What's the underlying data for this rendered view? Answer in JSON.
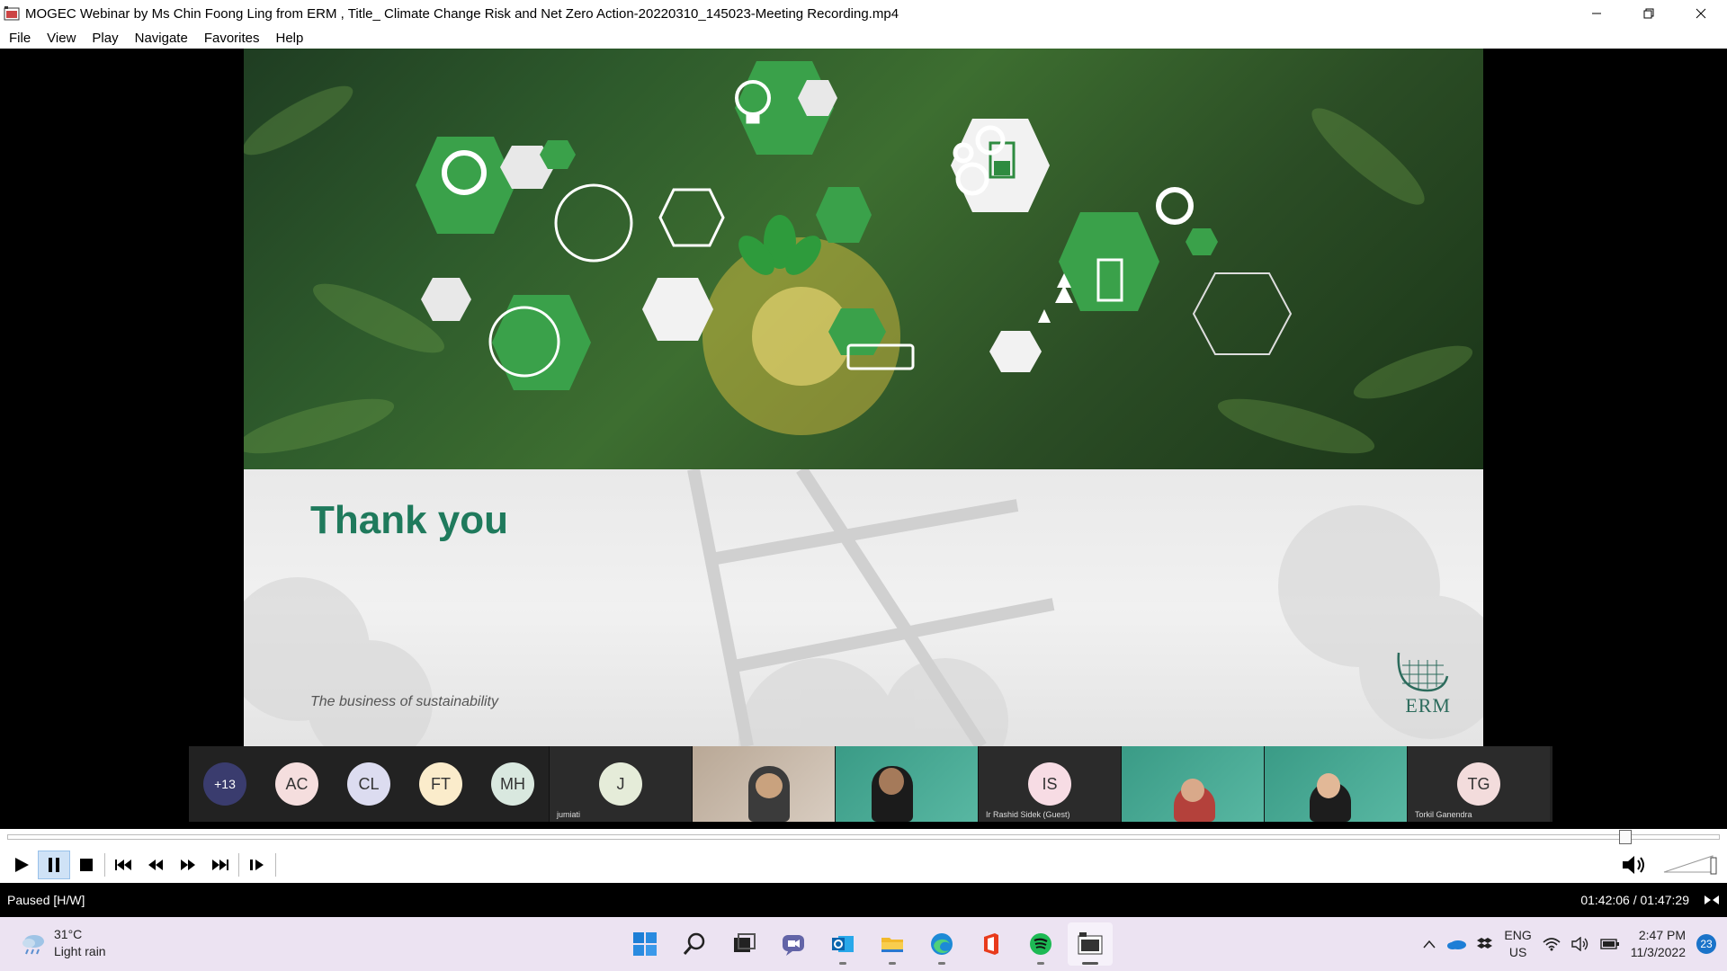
{
  "window": {
    "title": "MOGEC Webinar by Ms Chin Foong Ling from ERM , Title_ Climate Change Risk and Net Zero Action-20220310_145023-Meeting Recording.mp4"
  },
  "menu": {
    "items": [
      {
        "label": "File"
      },
      {
        "label": "View"
      },
      {
        "label": "Play"
      },
      {
        "label": "Navigate"
      },
      {
        "label": "Favorites"
      },
      {
        "label": "Help"
      }
    ]
  },
  "slide": {
    "heading": "Thank you",
    "tagline": "The business of sustainability",
    "logo_text": "ERM",
    "accent_color": "#1f7a5c"
  },
  "participants": {
    "overflow_count": "+13",
    "avatars": [
      {
        "initials": "AC",
        "color": "#f5dede"
      },
      {
        "initials": "CL",
        "color": "#dcdcf0"
      },
      {
        "initials": "FT",
        "color": "#fbeccb"
      },
      {
        "initials": "MH",
        "color": "#d9e8df"
      }
    ],
    "tiles": [
      {
        "kind": "avatar",
        "initials": "J",
        "name": "jumiati",
        "color": "#e5ecd9"
      },
      {
        "kind": "video",
        "name": "",
        "style": "office"
      },
      {
        "kind": "video",
        "name": "",
        "style": "teal"
      },
      {
        "kind": "avatar",
        "initials": "IS",
        "name": "Ir Rashid  Sidek (Guest)",
        "color": "#f7dce4"
      },
      {
        "kind": "video",
        "name": "",
        "style": "teal"
      },
      {
        "kind": "video",
        "name": "",
        "style": "teal"
      },
      {
        "kind": "avatar",
        "initials": "TG",
        "name": "Torkil Ganendra",
        "color": "#f3dcdc"
      }
    ]
  },
  "playback": {
    "progress": 0.9455,
    "status": "Paused [H/W]",
    "time": "01:42:06 / 01:47:29",
    "controls": [
      "play-icon",
      "pause-icon",
      "stop-icon",
      "previous-icon",
      "rewind-icon",
      "fast-forward-icon",
      "next-icon",
      "frame-step-icon"
    ],
    "volume_level": 1.0
  },
  "taskbar": {
    "weather": {
      "temp": "31°C",
      "condition": "Light rain"
    },
    "apps": [
      {
        "icon": "windows-start-icon",
        "active": false,
        "running": false
      },
      {
        "icon": "search-icon",
        "active": false,
        "running": false
      },
      {
        "icon": "task-view-icon",
        "active": false,
        "running": false
      },
      {
        "icon": "teams-chat-icon",
        "active": false,
        "running": false
      },
      {
        "icon": "outlook-icon",
        "active": false,
        "running": true
      },
      {
        "icon": "file-explorer-icon",
        "active": false,
        "running": true
      },
      {
        "icon": "edge-icon",
        "active": false,
        "running": true
      },
      {
        "icon": "office-icon",
        "active": false,
        "running": false
      },
      {
        "icon": "spotify-icon",
        "active": false,
        "running": true
      },
      {
        "icon": "media-player-icon",
        "active": true,
        "running": true
      }
    ],
    "language": {
      "line1": "ENG",
      "line2": "US"
    },
    "clock": {
      "time": "2:47 PM",
      "date": "11/3/2022"
    },
    "notifications": "23"
  }
}
